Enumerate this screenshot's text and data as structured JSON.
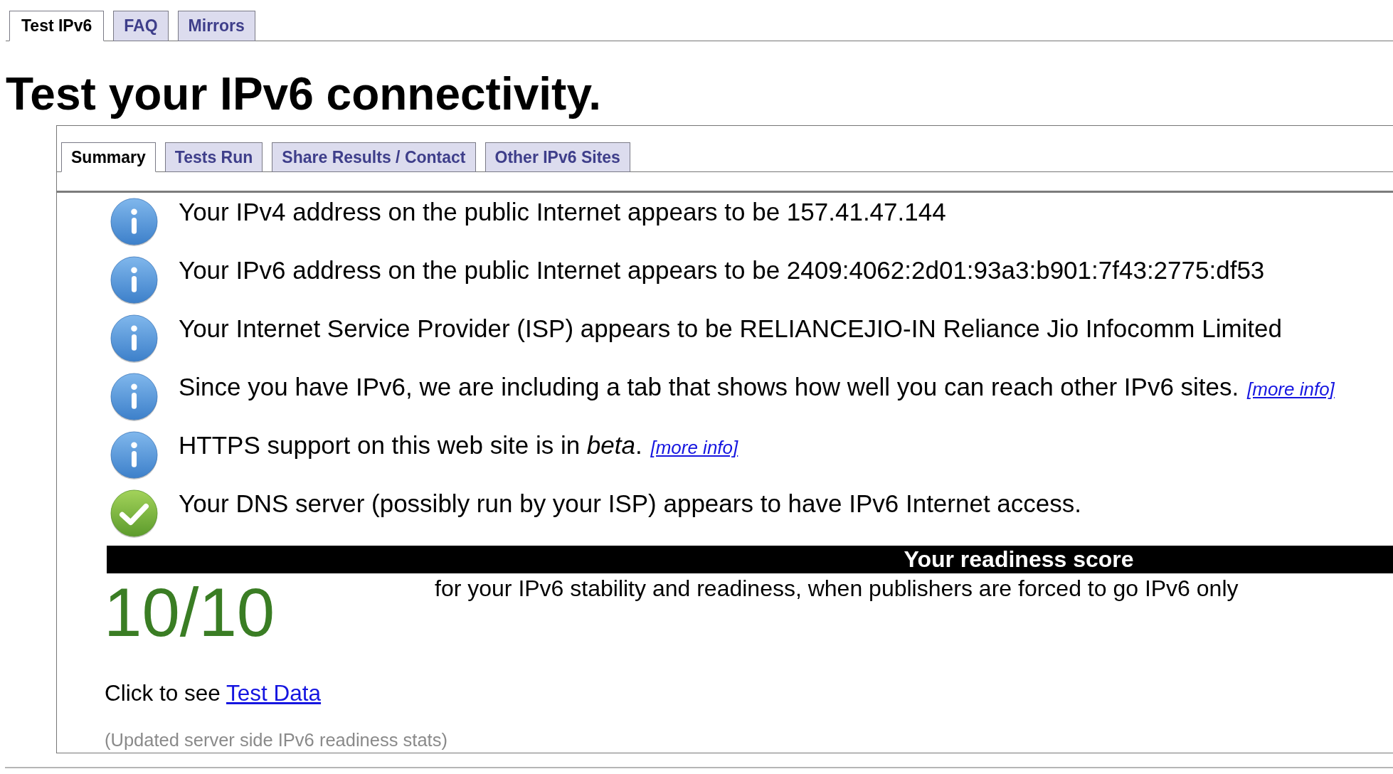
{
  "top_tabs": [
    {
      "label": "Test IPv6",
      "selected": true
    },
    {
      "label": "FAQ",
      "selected": false
    },
    {
      "label": "Mirrors",
      "selected": false
    }
  ],
  "heading": "Test your IPv6 connectivity.",
  "result_tabs": [
    {
      "label": "Summary",
      "selected": true
    },
    {
      "label": "Tests Run",
      "selected": false
    },
    {
      "label": "Share Results / Contact",
      "selected": false
    },
    {
      "label": "Other IPv6 Sites",
      "selected": false
    }
  ],
  "results": [
    {
      "kind": "info",
      "text": "Your IPv4 address on the public Internet appears to be 157.41.47.144"
    },
    {
      "kind": "info",
      "text": "Your IPv6 address on the public Internet appears to be 2409:4062:2d01:93a3:b901:7f43:2775:df53"
    },
    {
      "kind": "info",
      "text": "Your Internet Service Provider (ISP) appears to be RELIANCEJIO-IN Reliance Jio Infocomm Limited"
    },
    {
      "kind": "info",
      "text": "Since you have IPv6, we are including a tab that shows how well you can reach other IPv6 sites.",
      "link": "[more info]"
    },
    {
      "kind": "info",
      "text": "HTTPS support on this web site is in *beta*.",
      "link": "[more info]"
    },
    {
      "kind": "success",
      "text": "Your DNS server (possibly run by your ISP) appears to have IPv6 Internet access."
    }
  ],
  "score": {
    "title": "Your readiness score",
    "value": "10/10",
    "description": "for your IPv6 stability and readiness, when publishers are forced to go IPv6 only"
  },
  "test_data": {
    "prefix": "Click to see",
    "link": "Test Data"
  },
  "footnote": "(Updated server side IPv6 readiness stats)"
}
